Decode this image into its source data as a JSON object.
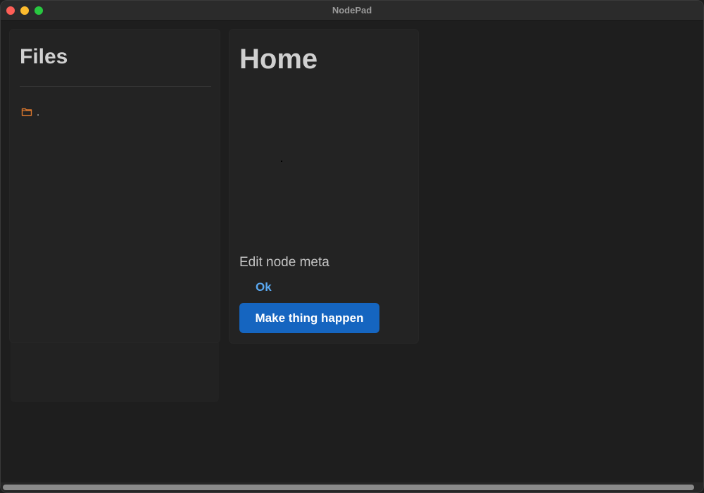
{
  "window": {
    "title": "NodePad"
  },
  "files": {
    "title": "Files",
    "items": [
      {
        "label": ".",
        "icon": "folder-icon",
        "icon_color": "#e07a2e"
      }
    ]
  },
  "home": {
    "title": "Home",
    "meta_label": "Edit node meta",
    "ok_label": "Ok",
    "action_label": "Make thing happen"
  },
  "colors": {
    "background": "#1e1e1e",
    "panel": "#232323",
    "accent": "#1565c0",
    "link": "#5aa8f0",
    "folder": "#e07a2e"
  }
}
